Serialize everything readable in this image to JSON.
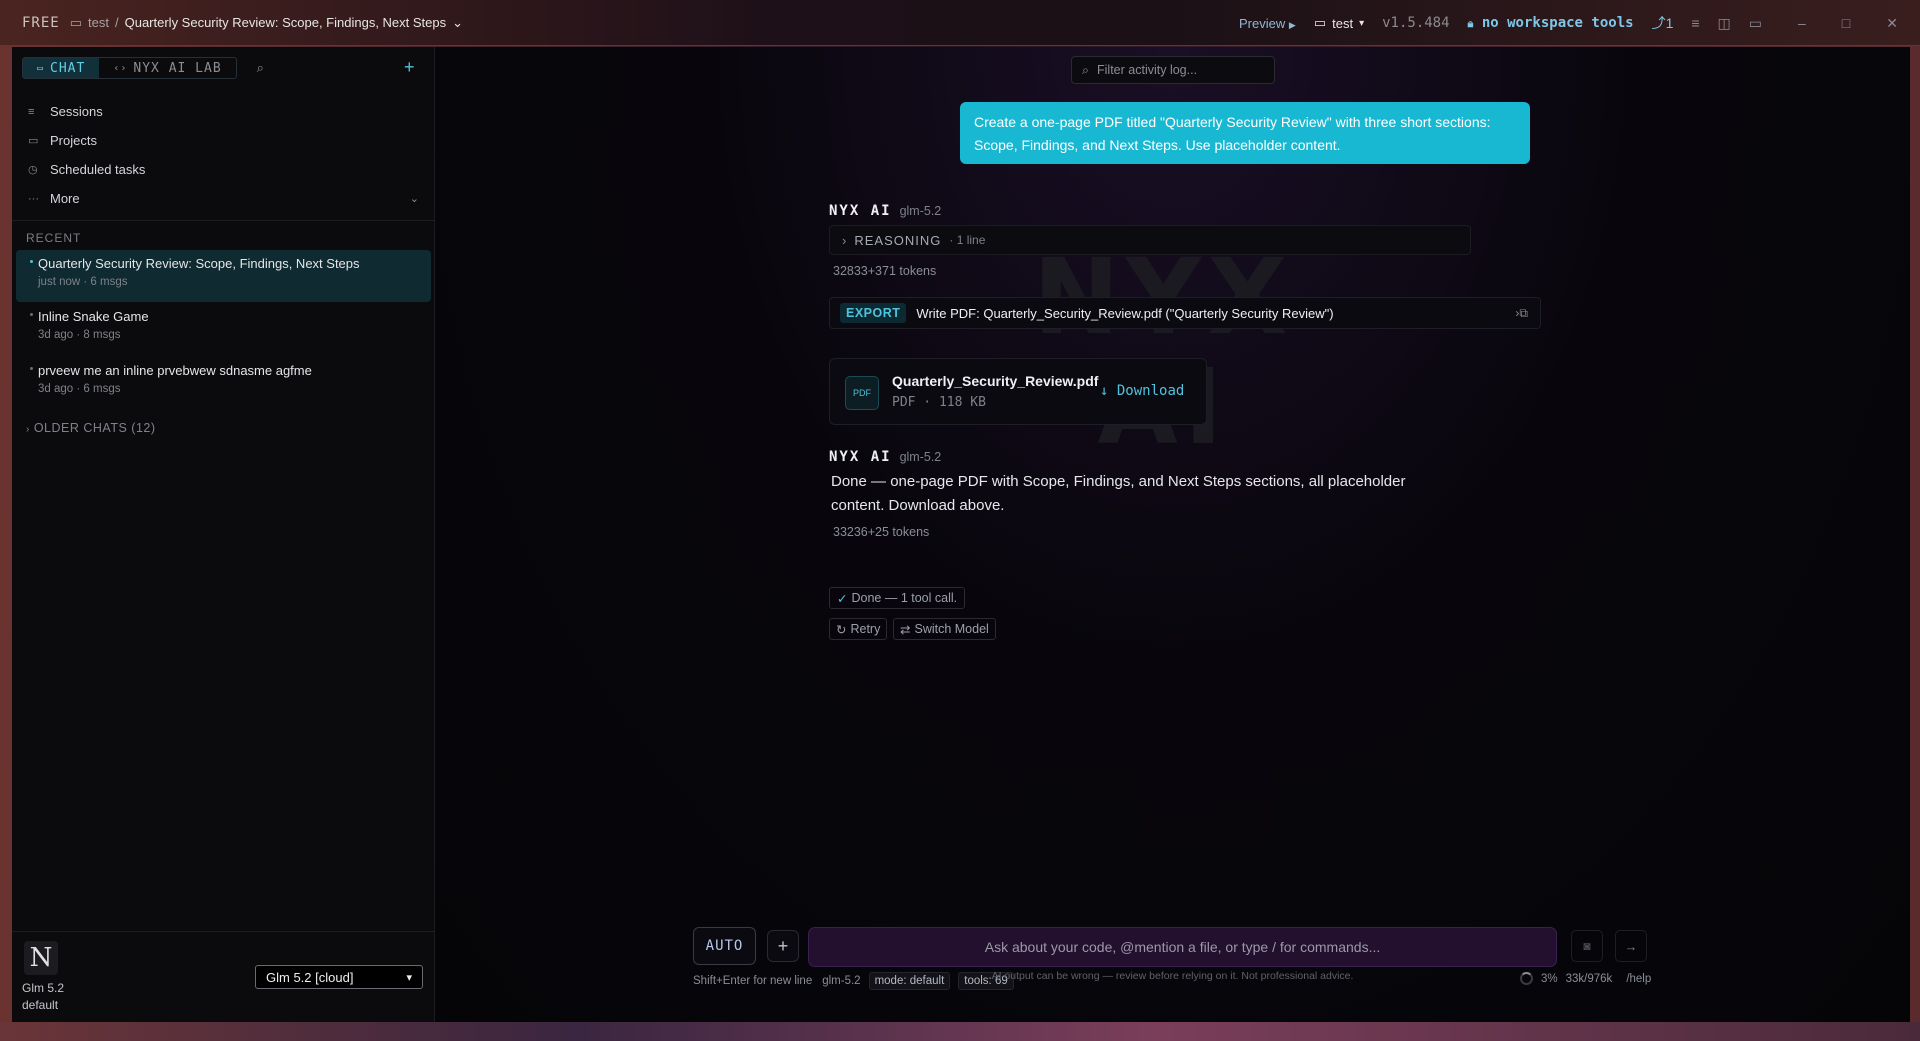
{
  "titlebar": {
    "free": "FREE",
    "folder": "test",
    "sep": "/",
    "chat_title": "Quarterly Security Review: Scope, Findings, Next Steps",
    "preview": "Preview",
    "workspace": "test",
    "version": "v1.5.484",
    "workspace_tools": "no workspace tools",
    "branch_count": "1"
  },
  "sidebar": {
    "tabs": [
      "CHAT",
      "NYX AI LAB"
    ],
    "nav": [
      "Sessions",
      "Projects",
      "Scheduled tasks",
      "More"
    ],
    "recent_header": "RECENT",
    "chats": [
      {
        "title": "Quarterly Security Review: Scope, Findings, Next Steps",
        "meta": "just now · 6 msgs"
      },
      {
        "title": "Inline Snake Game",
        "meta": "3d ago · 8 msgs"
      },
      {
        "title": "prveew me an inline prvebwew sdnasme agfme",
        "meta": "3d ago · 6 msgs"
      }
    ],
    "older": "OLDER CHATS  (12)",
    "avatar_letter": "N",
    "model_name": "Glm 5.2",
    "model_profile": "default",
    "model_select": "Glm 5.2 [cloud]"
  },
  "main": {
    "filter_placeholder": "Filter activity log...",
    "watermark": "NYX AI",
    "user_message": "Create a one-page PDF titled \"Quarterly Security Review\" with three short sections: Scope, Findings, and Next Steps. Use placeholder content.",
    "ai_name": "NYX AI",
    "ai_model": "glm-5.2",
    "reasoning_label": "REASONING",
    "reasoning_sub": "· 1 line",
    "tokens_1": "32833+371 tokens",
    "export_badge": "EXPORT",
    "export_text": "Write PDF: Quarterly_Security_Review.pdf (\"Quarterly Security Review\")",
    "file_name": "Quarterly_Security_Review.pdf",
    "file_meta": "PDF · 118 KB",
    "download": "Download",
    "ai_reply": "Done — one-page PDF with Scope, Findings, and Next Steps sections, all placeholder content. Download above.",
    "tokens_2": "33236+25 tokens",
    "done_chip": "Done — 1 tool call.",
    "retry": "Retry",
    "switch_model": "Switch Model"
  },
  "composer": {
    "mode_button": "AUTO",
    "placeholder": "Ask about your code, @mention a file, or type / for commands...",
    "hint": "Shift+Enter for new line",
    "model": "glm-5.2",
    "mode": "mode: default",
    "tools": "tools: 69",
    "context_pct": "3%",
    "context_tokens": "33k/976k",
    "help": "/help",
    "disclaimer": "AI output can be wrong — review before relying on it. Not professional advice."
  }
}
